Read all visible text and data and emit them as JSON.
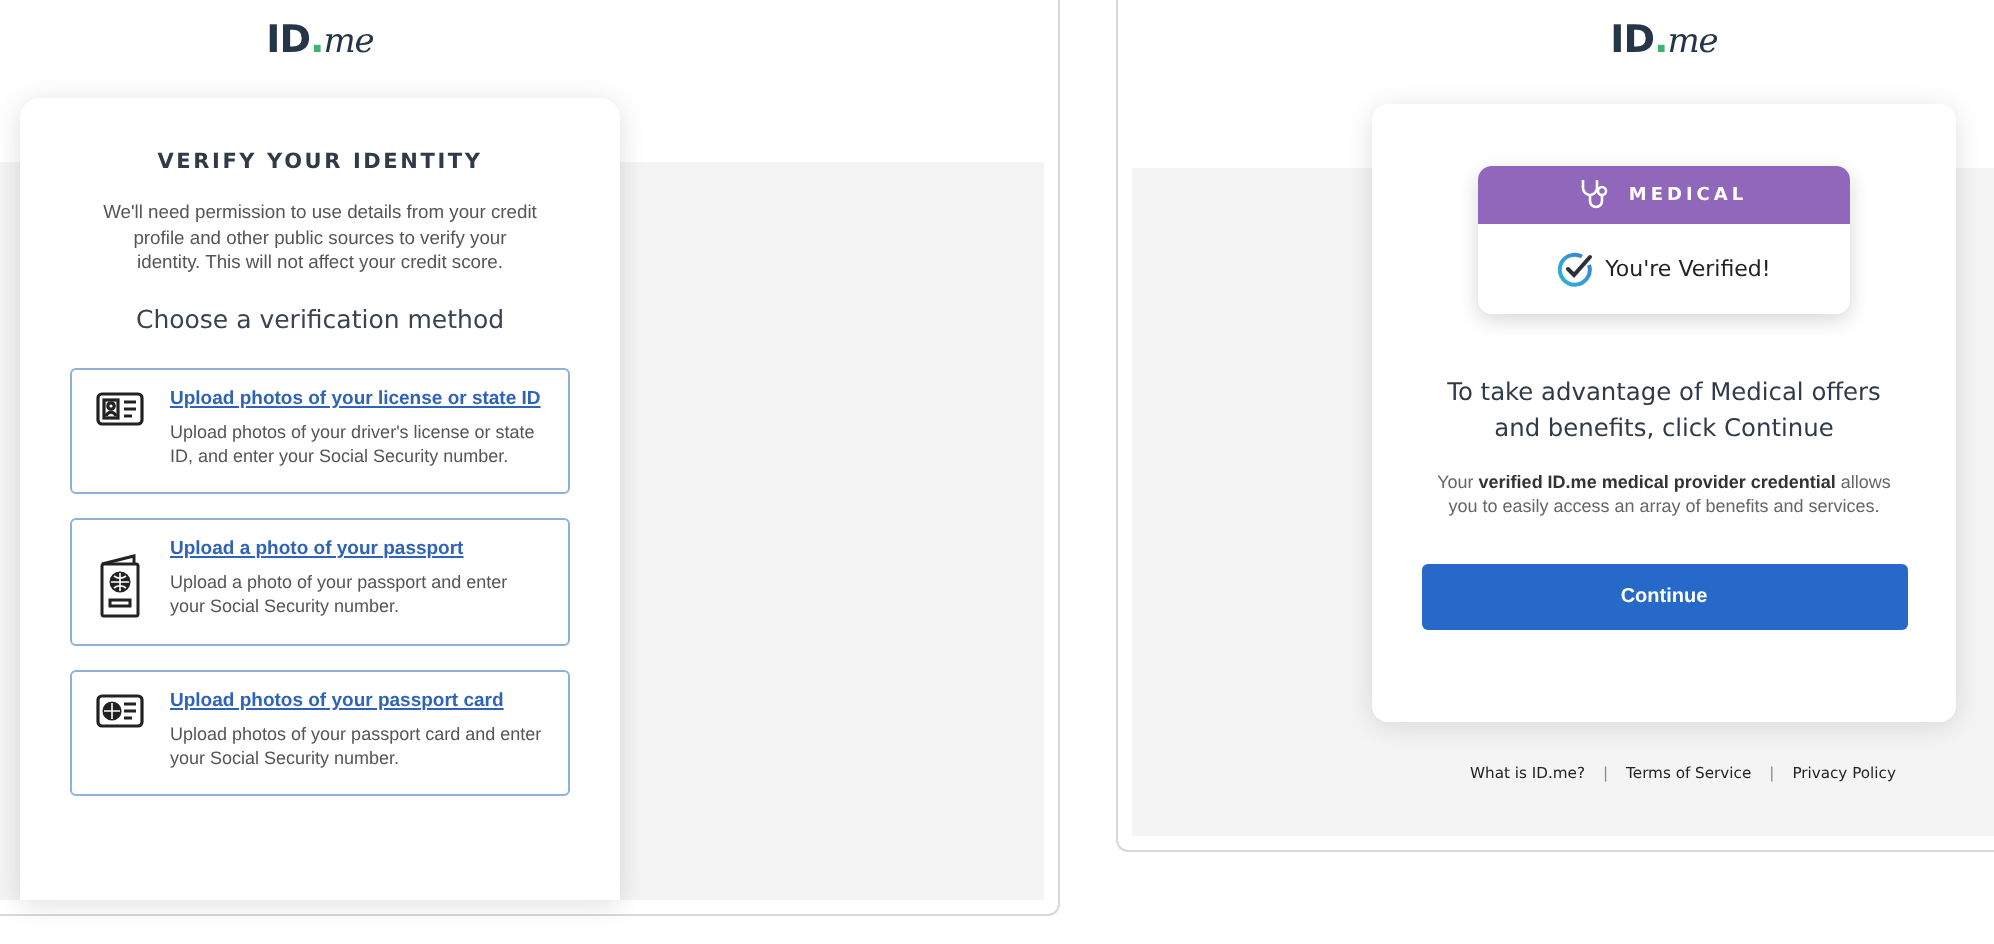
{
  "left_screen": {
    "logo": [
      "ID",
      ".",
      "me"
    ],
    "card": {
      "title": "VERIFY YOUR IDENTITY",
      "intro": "We'll need permission to use details from your credit profile and other public sources to verify your identity. This will not affect your credit score.",
      "heading": "Choose a verification method",
      "methods": [
        {
          "kind": "license",
          "title": "Upload photos of your license or state ID",
          "description": "Upload photos of your driver's license or state ID, and enter your Social Security number."
        },
        {
          "kind": "passport",
          "title": "Upload a photo of your passport",
          "description": "Upload a photo of your passport and enter your Social Security number."
        },
        {
          "kind": "passport_card",
          "title": "Upload photos of your passport card",
          "description": "Upload photos of your passport card and enter your Social Security number."
        }
      ]
    }
  },
  "right_screen": {
    "logo": [
      "ID",
      ".",
      "me"
    ],
    "card": {
      "badge": {
        "category": "MEDICAL",
        "status": "You're Verified!"
      },
      "heading": "To take advantage of Medical offers and benefits, click Continue",
      "body": "Your **verified ID.me medical provider credential** allows you to easily access an array of benefits and services.",
      "button": "Continue"
    },
    "footer": [
      {
        "kind": "link",
        "text": "What is ID.me?"
      },
      {
        "kind": "separator",
        "text": "|"
      },
      {
        "kind": "link",
        "text": "Terms of Service"
      },
      {
        "kind": "separator",
        "text": "|"
      },
      {
        "kind": "link",
        "text": "Privacy Policy"
      }
    ]
  }
}
